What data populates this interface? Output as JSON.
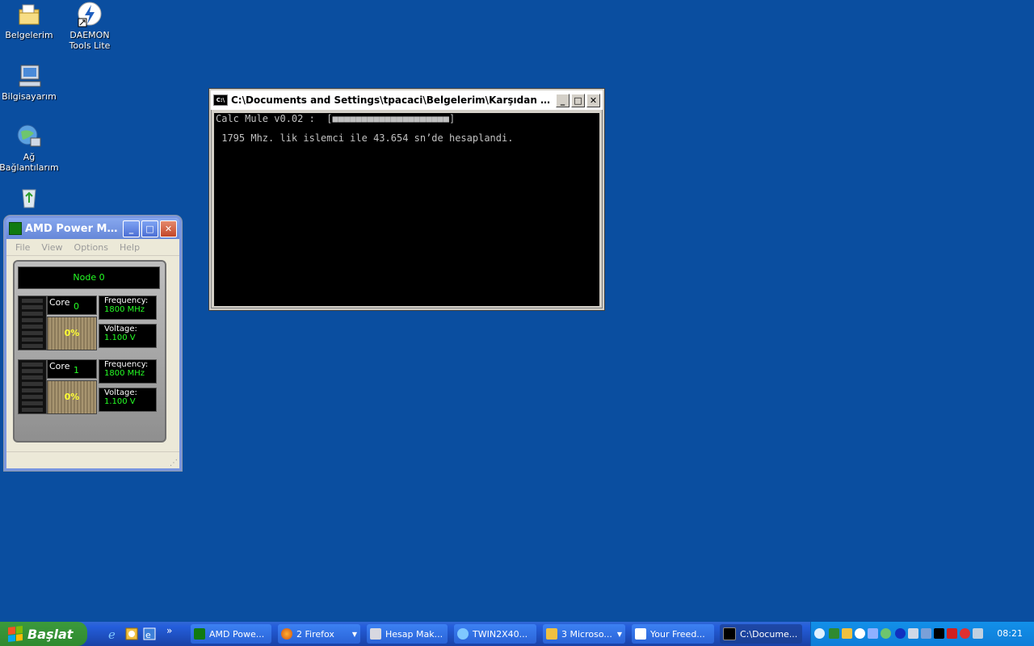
{
  "desktop": {
    "icons": [
      {
        "label": "Belgelerim"
      },
      {
        "label": "DAEMON Tools Lite"
      },
      {
        "label": "Bilgisayarım"
      },
      {
        "label": "Ağ Bağlantılarım"
      }
    ]
  },
  "console": {
    "title": "C:\\Documents and Settings\\tpacaci\\Belgelerim\\Karşıdan Yükle...",
    "line1": "Calc Mule v0.02 :  [■■■■■■■■■■■■■■■■■■■■]",
    "line2": " 1795 Mhz. lik islemci ile 43.654 sn’de hesaplandi."
  },
  "amd": {
    "title": "AMD Power Moni...",
    "menu": [
      "File",
      "View",
      "Options",
      "Help"
    ],
    "node": "Node 0",
    "cores": [
      {
        "label": "Core",
        "index": "0",
        "load": "0%",
        "freq_label": "Frequency:",
        "freq": "1800 MHz",
        "volt_label": "Voltage:",
        "volt": "1.100 V"
      },
      {
        "label": "Core",
        "index": "1",
        "load": "0%",
        "freq_label": "Frequency:",
        "freq": "1800 MHz",
        "volt_label": "Voltage:",
        "volt": "1.100 V"
      }
    ]
  },
  "taskbar": {
    "start": "Başlat",
    "tasks": [
      {
        "label": "AMD Powe...",
        "icon": "amd-icon"
      },
      {
        "label": "2 Firefox",
        "icon": "firefox-icon"
      },
      {
        "label": "Hesap Mak...",
        "icon": "calculator-icon"
      },
      {
        "label": "TWIN2X40...",
        "icon": "ie-icon"
      },
      {
        "label": "3 Microso...",
        "icon": "app-icon"
      },
      {
        "label": "Your Freed...",
        "icon": "document-icon"
      },
      {
        "label": "C:\\Docume...",
        "icon": "console-icon"
      }
    ],
    "clock": "08:21"
  }
}
